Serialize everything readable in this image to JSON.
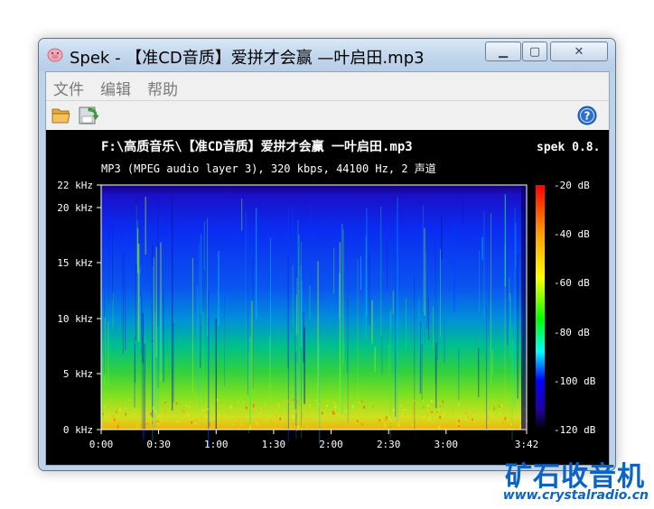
{
  "window": {
    "title": "Spek - 【准CD音质】爱拼才会赢 —叶启田.mp3",
    "controls": {
      "minimize": "▁",
      "maximize": "▢",
      "close": "✕"
    }
  },
  "menu": {
    "items": [
      "文件",
      "编辑",
      "帮助"
    ]
  },
  "toolbar": {
    "open_icon": "folder-open-icon",
    "save_icon": "save-icon",
    "help_icon": "help-icon"
  },
  "spectrogram": {
    "file_path": "F:\\高质音乐\\【准CD音质】爱拼才会赢 一叶启田.mp3",
    "brand": "spek 0.8.",
    "info": "MP3 (MPEG audio layer 3), 320 kbps, 44100 Hz, 2 声道",
    "freq_ticks": [
      "22 kHz",
      "20 kHz",
      "15 kHz",
      "10 kHz",
      "5 kHz",
      "0 kHz"
    ],
    "time_ticks": [
      "0:00",
      "0:30",
      "1:00",
      "1:30",
      "2:00",
      "2:30",
      "3:00",
      "3:42"
    ],
    "db_ticks": [
      "-20 dB",
      "-40 dB",
      "-60 dB",
      "-80 dB",
      "-100 dB",
      "-120 dB"
    ],
    "max_freq_khz": 22,
    "duration_s": 222,
    "db_range": [
      -120,
      -20
    ]
  },
  "watermark": {
    "text": "矿石收音机",
    "url": "www.crystalradio.cn"
  },
  "colors": {
    "accent": "#0a64c8",
    "plot_bg": "#000000"
  }
}
